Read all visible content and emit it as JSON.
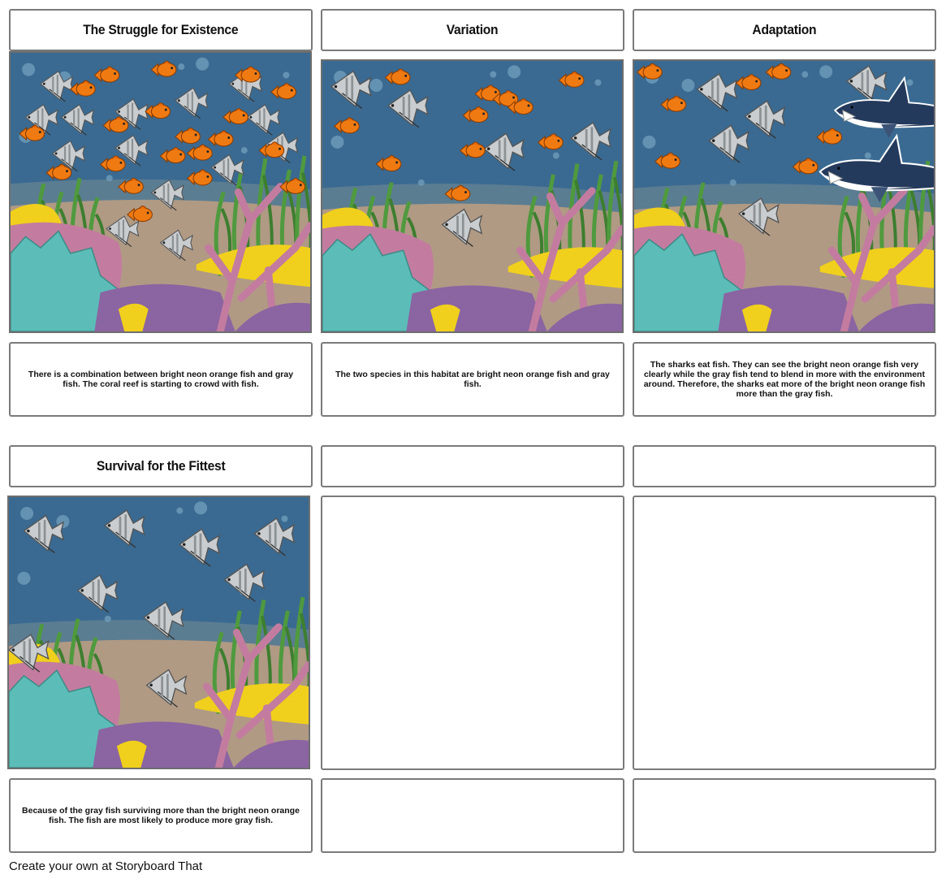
{
  "storyboard": {
    "footer_text": "Create your own at Storyboard That",
    "cells": [
      {
        "title": "The Struggle for Existence",
        "description": "There is a combination between bright neon orange fish and gray fish. The coral reef is starting to crowd with fish.",
        "scene": {
          "orange_fish": 20,
          "gray_fish": 14,
          "sharks": 0
        }
      },
      {
        "title": "Variation",
        "description": "The two species in this habitat are bright neon orange fish and gray fish.",
        "scene": {
          "orange_fish": 11,
          "gray_fish": 5,
          "sharks": 0
        }
      },
      {
        "title": "Adaptation",
        "description": "The sharks eat fish. They can see the bright neon orange fish very clearly while the gray fish tend to blend in more with the environment around. Therefore, the sharks eat more of the bright neon orange fish more than the gray fish.",
        "scene": {
          "orange_fish": 7,
          "gray_fish": 5,
          "sharks": 2
        }
      },
      {
        "title": "Survival for the Fittest",
        "description": "Because of the gray fish surviving more than the bright neon orange fish. The fish are most likely to produce more gray fish.",
        "scene": {
          "orange_fish": 0,
          "gray_fish": 9,
          "sharks": 0
        }
      },
      {
        "title": "",
        "description": "",
        "scene": null
      },
      {
        "title": "",
        "description": "",
        "scene": null
      }
    ]
  },
  "colors": {
    "water": "#3a6a91",
    "water_far": "#5b7d92",
    "sand": "#b09a84",
    "orange_fish": "#f07a12",
    "gray_fish": "#c9cdd0",
    "shark": "#243a5c",
    "coral_teal": "#5cbdb8",
    "coral_pink": "#c37c9f",
    "coral_purple": "#8b64a2",
    "coral_yellow": "#f0d01c",
    "seaweed": "#4f9a3e",
    "border": "#7a7a7a"
  }
}
